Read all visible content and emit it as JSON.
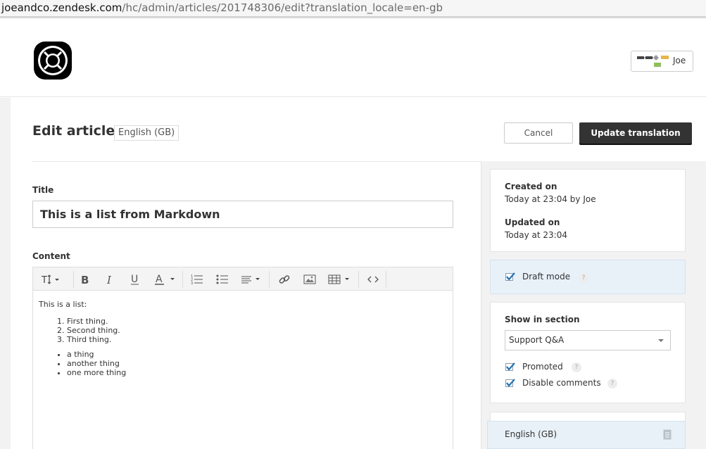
{
  "browser": {
    "url_host": "joeandco.zendesk.com",
    "url_path": "/hc/admin/articles/201748306/edit?translation_locale=en-gb"
  },
  "header": {
    "user_name": "Joe"
  },
  "page": {
    "title": "Edit article",
    "locale": "English (GB)",
    "cancel_label": "Cancel",
    "update_label": "Update translation"
  },
  "form": {
    "title_label": "Title",
    "title_value": "This is a list from Markdown",
    "content_label": "Content",
    "content": {
      "intro": "This is a list:",
      "ordered": [
        "First thing.",
        "Second thing.",
        "Third thing."
      ],
      "unordered": [
        "a thing",
        "another thing",
        "one more thing"
      ]
    }
  },
  "toolbar": {
    "icons": [
      "text-size-icon",
      "bold-icon",
      "italic-icon",
      "underline-icon",
      "text-color-icon",
      "ordered-list-icon",
      "unordered-list-icon",
      "align-icon",
      "link-icon",
      "image-icon",
      "table-icon",
      "source-code-icon"
    ]
  },
  "sidebar": {
    "created_label": "Created on",
    "created_value": "Today at 23:04 by Joe",
    "updated_label": "Updated on",
    "updated_value": "Today at 23:04",
    "draft_label": "Draft mode",
    "draft_checked": true,
    "section_label": "Show in section",
    "section_value": "Support Q&A",
    "promoted_label": "Promoted",
    "promoted_checked": true,
    "disable_comments_label": "Disable comments",
    "disable_comments_checked": true,
    "help_glyph": "?",
    "translation_label": "English (GB)"
  },
  "colors": {
    "primary_button": "#333333",
    "highlight_panel": "#e8f1f8",
    "checkbox_blue": "#1f73b7"
  }
}
